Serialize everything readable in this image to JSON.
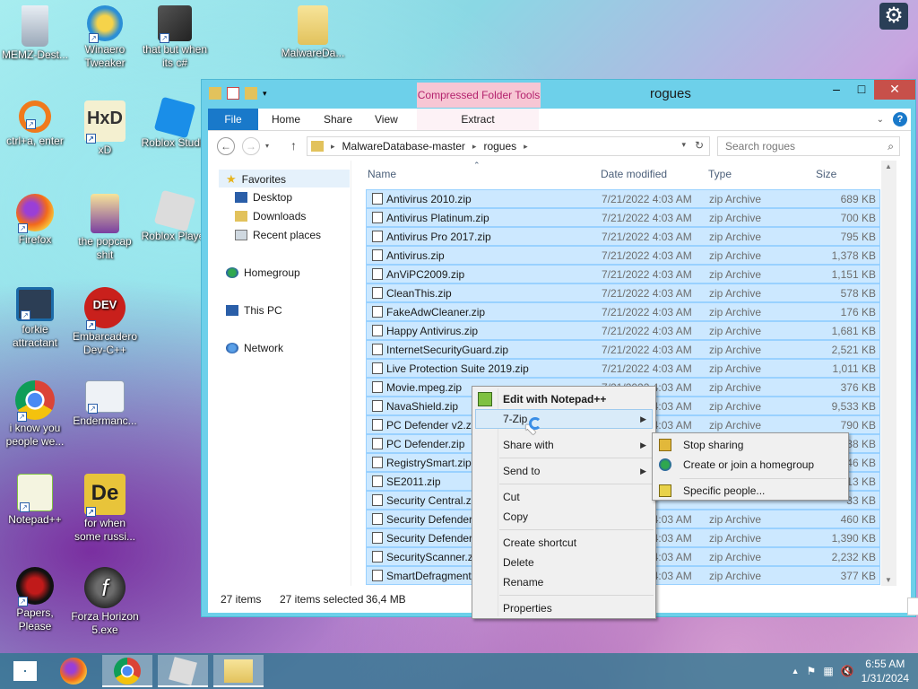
{
  "desktop": {
    "icons": [
      {
        "label": "MEMZ-Dest...",
        "icon": "recycle-bin-icon"
      },
      {
        "label": "Winaero Tweaker",
        "icon": "winaero-icon"
      },
      {
        "label": "that but when its c#",
        "icon": "stacked-windows-icon"
      },
      {
        "label": "MalwareDa...",
        "icon": "folder-icon"
      },
      {
        "label": "ctrl+a, enter",
        "icon": "magnifier-icon"
      },
      {
        "label": "xD",
        "icon": "hxd-icon"
      },
      {
        "label": "Roblox Studio",
        "icon": "roblox-studio-icon"
      },
      {
        "label": "Firefox",
        "icon": "firefox-icon"
      },
      {
        "label": "the popcap shit",
        "icon": "popcap-folder-icon"
      },
      {
        "label": "Roblox Player",
        "icon": "roblox-icon"
      },
      {
        "label": "forkie attractant",
        "icon": "monitor-gear-icon"
      },
      {
        "label": "Embarcadero Dev-C++",
        "icon": "devcpp-icon"
      },
      {
        "label": "i know you people we...",
        "icon": "chrome-icon"
      },
      {
        "label": "Endermanc...",
        "icon": "window-app-icon"
      },
      {
        "label": "Notepad++",
        "icon": "notepadpp-icon"
      },
      {
        "label": "for when some russi...",
        "icon": "dependency-icon"
      },
      {
        "label": "Papers, Please",
        "icon": "papers-please-icon"
      },
      {
        "label": "Forza Horizon 5.exe",
        "icon": "flash-icon"
      }
    ]
  },
  "explorer": {
    "title": "rogues",
    "context_tab_group": "Compressed Folder Tools",
    "ribbon_tabs": [
      "File",
      "Home",
      "Share",
      "View",
      "Extract"
    ],
    "breadcrumb": [
      "MalwareDatabase-master",
      "rogues"
    ],
    "search_placeholder": "Search rogues",
    "nav_pane": {
      "favorites": "Favorites",
      "desktop": "Desktop",
      "downloads": "Downloads",
      "recent": "Recent places",
      "homegroup": "Homegroup",
      "thispc": "This PC",
      "network": "Network"
    },
    "columns": {
      "name": "Name",
      "date": "Date modified",
      "type": "Type",
      "size": "Size"
    },
    "files": [
      {
        "name": "Antivirus 2010.zip",
        "date": "7/21/2022 4:03 AM",
        "type": "zip Archive",
        "size": "689 KB"
      },
      {
        "name": "Antivirus Platinum.zip",
        "date": "7/21/2022 4:03 AM",
        "type": "zip Archive",
        "size": "700 KB"
      },
      {
        "name": "Antivirus Pro 2017.zip",
        "date": "7/21/2022 4:03 AM",
        "type": "zip Archive",
        "size": "795 KB"
      },
      {
        "name": "Antivirus.zip",
        "date": "7/21/2022 4:03 AM",
        "type": "zip Archive",
        "size": "1,378 KB"
      },
      {
        "name": "AnViPC2009.zip",
        "date": "7/21/2022 4:03 AM",
        "type": "zip Archive",
        "size": "1,151 KB"
      },
      {
        "name": "CleanThis.zip",
        "date": "7/21/2022 4:03 AM",
        "type": "zip Archive",
        "size": "578 KB"
      },
      {
        "name": "FakeAdwCleaner.zip",
        "date": "7/21/2022 4:03 AM",
        "type": "zip Archive",
        "size": "176 KB"
      },
      {
        "name": "Happy Antivirus.zip",
        "date": "7/21/2022 4:03 AM",
        "type": "zip Archive",
        "size": "1,681 KB"
      },
      {
        "name": "InternetSecurityGuard.zip",
        "date": "7/21/2022 4:03 AM",
        "type": "zip Archive",
        "size": "2,521 KB"
      },
      {
        "name": "Live Protection Suite 2019.zip",
        "date": "7/21/2022 4:03 AM",
        "type": "zip Archive",
        "size": "1,011 KB"
      },
      {
        "name": "Movie.mpeg.zip",
        "date": "7/21/2022 4:03 AM",
        "type": "zip Archive",
        "size": "376 KB"
      },
      {
        "name": "NavaShield.zip",
        "date": "7/21/2022 4:03 AM",
        "type": "zip Archive",
        "size": "9,533 KB"
      },
      {
        "name": "PC Defender v2.zip",
        "date": "7/21/2022 4:03 AM",
        "type": "zip Archive",
        "size": "790 KB"
      },
      {
        "name": "PC Defender.zip",
        "date": "",
        "type": "",
        "size": "38 KB"
      },
      {
        "name": "RegistrySmart.zip",
        "date": "",
        "type": "",
        "size": "46 KB"
      },
      {
        "name": "SE2011.zip",
        "date": "",
        "type": "",
        "size": "13 KB"
      },
      {
        "name": "Security Central.zip",
        "date": "",
        "type": "",
        "size": "33 KB"
      },
      {
        "name": "Security Defender",
        "date": "7/21/2022 4:03 AM",
        "type": "zip Archive",
        "size": "460 KB"
      },
      {
        "name": "Security Defender.",
        "date": "7/21/2022 4:03 AM",
        "type": "zip Archive",
        "size": "1,390 KB"
      },
      {
        "name": "SecurityScanner.zi",
        "date": "7/21/2022 4:03 AM",
        "type": "zip Archive",
        "size": "2,232 KB"
      },
      {
        "name": "SmartDefragmente",
        "date": "7/21/2022 4:03 AM",
        "type": "zip Archive",
        "size": "377 KB"
      }
    ],
    "status": {
      "count": "27 items",
      "selected": "27 items selected",
      "size": "36,4 MB"
    }
  },
  "context_menu": {
    "items": [
      "Edit with Notepad++",
      "7-Zip",
      "Share with",
      "Send to",
      "Cut",
      "Copy",
      "Create shortcut",
      "Delete",
      "Rename",
      "Properties"
    ]
  },
  "share_submenu": {
    "items": [
      "Stop sharing",
      "Create or join a homegroup",
      "Specific people..."
    ]
  },
  "taskbar": {
    "time": "6:55 AM",
    "date": "1/31/2024"
  },
  "colors": {
    "selection": "#cce8ff",
    "file_tab": "#1979ca",
    "close_button": "#c7504a"
  }
}
